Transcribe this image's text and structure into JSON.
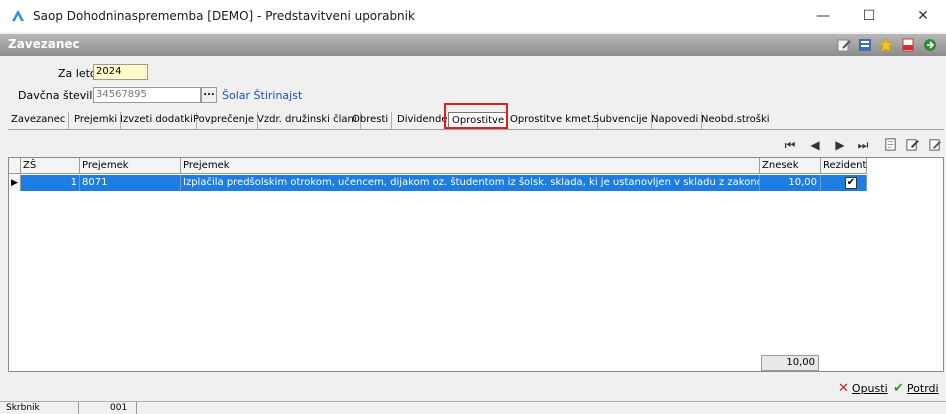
{
  "window": {
    "title": "Saop Dohodninasprememba [DEMO] - Predstavitveni uporabnik",
    "minimize": "—",
    "maximize": "☐",
    "close": "✕"
  },
  "section": {
    "title": "Zavezanec"
  },
  "form": {
    "za_leto_label": "Za leto",
    "za_leto_value": "2024",
    "davcna_label": "Davčna številka",
    "davcna_value": "34567895",
    "lookup_label": "...",
    "davcna_name": "Šolar Štirinajst"
  },
  "tabs": [
    "Zavezanec",
    "Prejemki",
    "Izvzeti dodatki",
    "Povprečenje",
    "Vzdr. družinski člani",
    "Obresti",
    "Dividende",
    "Oprostitve",
    "Oprostitve kmet.",
    "Subvencije",
    "Napovedi",
    "Neobd.stroški"
  ],
  "active_tab": "Oprostitve",
  "nav": {
    "first": "⏮",
    "prev": "◀",
    "next": "▶",
    "last": "⏭"
  },
  "grid": {
    "headers": [
      "ZŠ",
      "Prejemek",
      "Prejemek",
      "Znesek",
      "Rezident"
    ],
    "rows": [
      {
        "zs": "1",
        "code": "8071",
        "description": "Izplačila predšolskim otrokom, učencem, dijakom oz. študentom iz šolsk. sklada, ki je ustanovljen v skladu z zakonom,...",
        "amount": "10,00",
        "rezident": "✔"
      }
    ],
    "total": "10,00"
  },
  "actions": {
    "cancel": "Opusti",
    "confirm": "Potrdi"
  },
  "status": {
    "label": "Skrbnik",
    "code": "001"
  },
  "colors": {
    "selection": "#1e7de0",
    "highlight": "#e02020",
    "link": "#1a4fbf"
  }
}
